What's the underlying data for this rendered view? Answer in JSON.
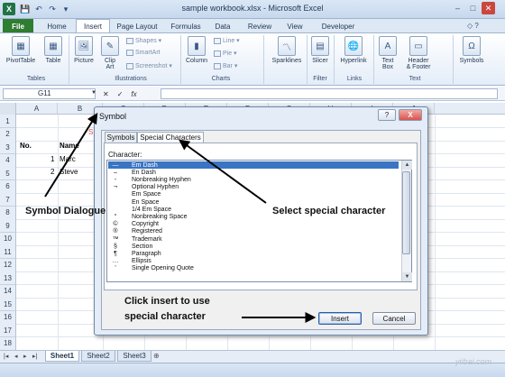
{
  "window": {
    "title": "sample workbook.xlsx - Microsoft Excel",
    "controls": [
      "–",
      "□",
      "✕"
    ]
  },
  "quick_access": [
    "X",
    "💾",
    "↶",
    "↷",
    "▾"
  ],
  "ribbon_tabs": [
    "File",
    "Home",
    "Insert",
    "Page Layout",
    "Formulas",
    "Data",
    "Review",
    "View",
    "Developer"
  ],
  "ribbon": {
    "buttons": [
      {
        "label": "PivotTable",
        "icon": "pivottable-icon",
        "glyph": "▦"
      },
      {
        "label": "Table",
        "icon": "table-icon",
        "glyph": "▦"
      },
      {
        "label": "Picture",
        "icon": "picture-icon",
        "glyph": "🖼"
      },
      {
        "label": "Clip\nArt",
        "icon": "clipart-icon",
        "glyph": "✎"
      },
      {
        "label": "Column",
        "icon": "column-chart-icon",
        "glyph": "▮"
      },
      {
        "label": "Sparklines",
        "icon": "sparklines-icon",
        "glyph": "〽"
      },
      {
        "label": "Slicer",
        "icon": "slicer-icon",
        "glyph": "▤"
      },
      {
        "label": "Hyperlink",
        "icon": "hyperlink-icon",
        "glyph": "🌐"
      },
      {
        "label": "Text\nBox",
        "icon": "textbox-icon",
        "glyph": "A"
      },
      {
        "label": "Header\n& Footer",
        "icon": "header-footer-icon",
        "glyph": "▭"
      },
      {
        "label": "Symbols",
        "icon": "symbols-icon",
        "glyph": "Ω"
      }
    ],
    "small_items": [
      "Shapes ▾",
      "SmartArt",
      "Screenshot ▾",
      "Line ▾",
      "Pie ▾",
      "Bar ▾"
    ],
    "groups": [
      "Tables",
      "Illustrations",
      "Charts",
      "Filter",
      "Links",
      "Text"
    ]
  },
  "formula_bar": {
    "name_box": "G11",
    "icons": [
      "✕",
      "✓",
      "fx"
    ],
    "value": ""
  },
  "grid": {
    "columns": [
      "A",
      "B",
      "C",
      "D",
      "E",
      "F",
      "G",
      "H",
      "I",
      "J"
    ],
    "rows": [
      "1",
      "2",
      "3",
      "4",
      "5",
      "6",
      "7",
      "8",
      "9",
      "10",
      "11",
      "12",
      "13",
      "14",
      "15",
      "16",
      "17",
      "18"
    ],
    "cells": {
      "header_no": "No.",
      "header_name": "Name",
      "r4_no": "1",
      "r4_name": "Marc",
      "r5_no": "2",
      "r5_name": "Steve",
      "partial_b": "S"
    }
  },
  "sheets": [
    "Sheet1",
    "Sheet2",
    "Sheet3"
  ],
  "sheet_nav": [
    "|◂",
    "◂",
    "▸",
    "▸|"
  ],
  "status": "",
  "dialog": {
    "title": "Symbol",
    "help": "?",
    "close": "X",
    "tabs": [
      "Symbols",
      "Special Characters"
    ],
    "character_label": "Character:",
    "rows": [
      {
        "symbol": "—",
        "name": "Em Dash",
        "selected": true
      },
      {
        "symbol": "–",
        "name": "En Dash",
        "selected": false
      },
      {
        "symbol": "‑",
        "name": "Nonbreaking Hyphen",
        "selected": false
      },
      {
        "symbol": "¬",
        "name": "Optional Hyphen",
        "selected": false
      },
      {
        "symbol": "",
        "name": "Em Space",
        "selected": false
      },
      {
        "symbol": "",
        "name": "En Space",
        "selected": false
      },
      {
        "symbol": "",
        "name": "1/4 Em Space",
        "selected": false
      },
      {
        "symbol": "°",
        "name": "Nonbreaking Space",
        "selected": false
      },
      {
        "symbol": "©",
        "name": "Copyright",
        "selected": false
      },
      {
        "symbol": "®",
        "name": "Registered",
        "selected": false
      },
      {
        "symbol": "™",
        "name": "Trademark",
        "selected": false
      },
      {
        "symbol": "§",
        "name": "Section",
        "selected": false
      },
      {
        "symbol": "¶",
        "name": "Paragraph",
        "selected": false
      },
      {
        "symbol": "…",
        "name": "Ellipsis",
        "selected": false
      },
      {
        "symbol": "'",
        "name": "Single Opening Quote",
        "selected": false
      }
    ],
    "insert_label": "Insert",
    "cancel_label": "Cancel"
  },
  "annotations": {
    "symbol_dialogue": "Symbol Dialogue",
    "select_special": "Select special character",
    "click_insert_1": "Click insert to use",
    "click_insert_2": "special character"
  },
  "watermark": "yiibai.com"
}
